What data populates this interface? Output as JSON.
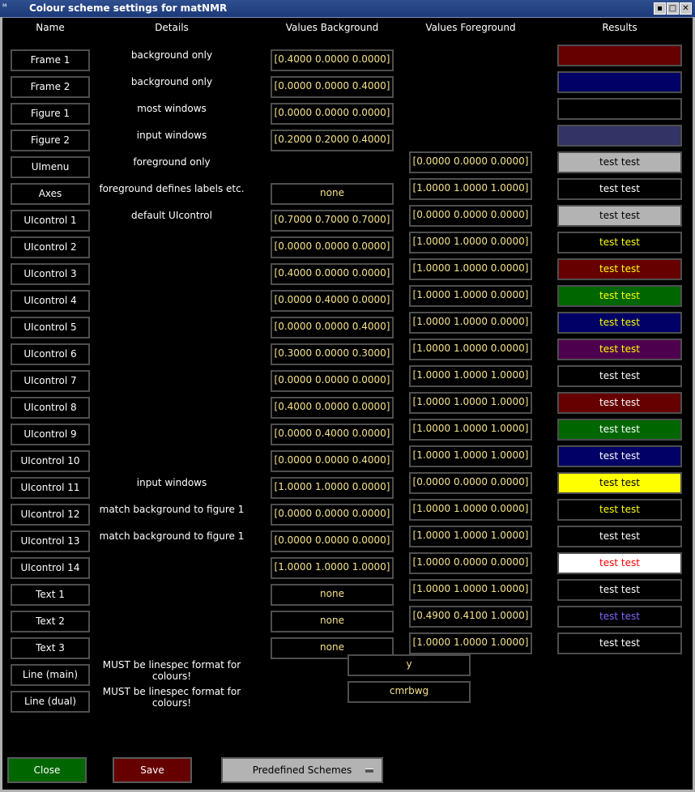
{
  "window": {
    "title": "Colour scheme settings for matNMR",
    "app_icon_label": "ᴹ"
  },
  "headers": {
    "name": "Name",
    "details": "Details",
    "values_background": "Values Background",
    "values_foreground": "Values Foreground",
    "results": "Results"
  },
  "rows": [
    {
      "name": "Frame 1",
      "details": "background only",
      "bg": "[0.4000 0.0000 0.0000]",
      "fg": "",
      "result": "",
      "res_bg": "#660000",
      "res_fg": "#ffffff"
    },
    {
      "name": "Frame 2",
      "details": "background only",
      "bg": "[0.0000 0.0000 0.4000]",
      "fg": "",
      "result": "",
      "res_bg": "#000066",
      "res_fg": "#ffffff"
    },
    {
      "name": "Figure 1",
      "details": "most windows",
      "bg": "[0.0000 0.0000 0.0000]",
      "fg": "",
      "result": "",
      "res_bg": "#000000",
      "res_fg": "#ffffff"
    },
    {
      "name": "Figure 2",
      "details": "input windows",
      "bg": "[0.2000 0.2000 0.4000]",
      "fg": "",
      "result": "",
      "res_bg": "#333366",
      "res_fg": "#ffffff"
    },
    {
      "name": "UImenu",
      "details": "foreground only",
      "bg": "",
      "fg": "[0.0000 0.0000 0.0000]",
      "result": "test test",
      "res_bg": "#b3b3b3",
      "res_fg": "#000000"
    },
    {
      "name": "Axes",
      "details": "foreground defines labels etc.",
      "bg": "none",
      "fg": "[1.0000 1.0000 1.0000]",
      "result": "test test",
      "res_bg": "#000000",
      "res_fg": "#ffffff"
    },
    {
      "name": "UIcontrol 1",
      "details": "default UIcontrol",
      "bg": "[0.7000 0.7000 0.7000]",
      "fg": "[0.0000 0.0000 0.0000]",
      "result": "test test",
      "res_bg": "#b3b3b3",
      "res_fg": "#000000"
    },
    {
      "name": "UIcontrol 2",
      "details": "",
      "bg": "[0.0000 0.0000 0.0000]",
      "fg": "[1.0000 1.0000 0.0000]",
      "result": "test test",
      "res_bg": "#000000",
      "res_fg": "#ffff00"
    },
    {
      "name": "UIcontrol 3",
      "details": "",
      "bg": "[0.4000 0.0000 0.0000]",
      "fg": "[1.0000 1.0000 0.0000]",
      "result": "test test",
      "res_bg": "#660000",
      "res_fg": "#ffff00"
    },
    {
      "name": "UIcontrol 4",
      "details": "",
      "bg": "[0.0000 0.4000 0.0000]",
      "fg": "[1.0000 1.0000 0.0000]",
      "result": "test test",
      "res_bg": "#006600",
      "res_fg": "#ffff00"
    },
    {
      "name": "UIcontrol 5",
      "details": "",
      "bg": "[0.0000 0.0000 0.4000]",
      "fg": "[1.0000 1.0000 0.0000]",
      "result": "test test",
      "res_bg": "#000066",
      "res_fg": "#ffff00"
    },
    {
      "name": "UIcontrol 6",
      "details": "",
      "bg": "[0.3000 0.0000 0.3000]",
      "fg": "[1.0000 1.0000 0.0000]",
      "result": "test test",
      "res_bg": "#4d004d",
      "res_fg": "#ffff00"
    },
    {
      "name": "UIcontrol 7",
      "details": "",
      "bg": "[0.0000 0.0000 0.0000]",
      "fg": "[1.0000 1.0000 1.0000]",
      "result": "test test",
      "res_bg": "#000000",
      "res_fg": "#ffffff"
    },
    {
      "name": "UIcontrol 8",
      "details": "",
      "bg": "[0.4000 0.0000 0.0000]",
      "fg": "[1.0000 1.0000 1.0000]",
      "result": "test test",
      "res_bg": "#660000",
      "res_fg": "#ffffff"
    },
    {
      "name": "UIcontrol 9",
      "details": "",
      "bg": "[0.0000 0.4000 0.0000]",
      "fg": "[1.0000 1.0000 1.0000]",
      "result": "test test",
      "res_bg": "#006600",
      "res_fg": "#ffffff"
    },
    {
      "name": "UIcontrol 10",
      "details": "",
      "bg": "[0.0000 0.0000 0.4000]",
      "fg": "[1.0000 1.0000 1.0000]",
      "result": "test test",
      "res_bg": "#000066",
      "res_fg": "#ffffff"
    },
    {
      "name": "UIcontrol 11",
      "details": "input windows",
      "bg": "[1.0000 1.0000 0.0000]",
      "fg": "[0.0000 0.0000 0.0000]",
      "result": "test test",
      "res_bg": "#ffff00",
      "res_fg": "#000000"
    },
    {
      "name": "UIcontrol 12",
      "details": "match background to figure 1",
      "bg": "[0.0000 0.0000 0.0000]",
      "fg": "[1.0000 1.0000 0.0000]",
      "result": "test test",
      "res_bg": "#000000",
      "res_fg": "#ffff00"
    },
    {
      "name": "UIcontrol 13",
      "details": "match background to figure 1",
      "bg": "[0.0000 0.0000 0.0000]",
      "fg": "[1.0000 1.0000 1.0000]",
      "result": "test test",
      "res_bg": "#000000",
      "res_fg": "#ffffff"
    },
    {
      "name": "UIcontrol 14",
      "details": "",
      "bg": "[1.0000 1.0000 1.0000]",
      "fg": "[1.0000 0.0000 0.0000]",
      "result": "test test",
      "res_bg": "#ffffff",
      "res_fg": "#ff0000"
    },
    {
      "name": "Text 1",
      "details": "",
      "bg": "none",
      "fg": "[1.0000 1.0000 1.0000]",
      "result": "test test",
      "res_bg": "#000000",
      "res_fg": "#ffffff"
    },
    {
      "name": "Text 2",
      "details": "",
      "bg": "none",
      "fg": "[0.4900 0.4100 1.0000]",
      "result": "test test",
      "res_bg": "#000000",
      "res_fg": "#7d69ff"
    },
    {
      "name": "Text 3",
      "details": "",
      "bg": "none",
      "fg": "[1.0000 1.0000 1.0000]",
      "result": "test test",
      "res_bg": "#000000",
      "res_fg": "#ffffff"
    }
  ],
  "lines": [
    {
      "name": "Line (main)",
      "details": "MUST be linespec format for colours!",
      "value": "y"
    },
    {
      "name": "Line (dual)",
      "details": "MUST be linespec format for colours!",
      "value": "cmrbwg"
    }
  ],
  "buttons": {
    "close": "Close",
    "save": "Save",
    "predefined": "Predefined Schemes"
  },
  "colors": {
    "close_bg": "#006600",
    "save_bg": "#660000",
    "popup_bg": "#b3b3b3",
    "value_text": "#f5e28c"
  }
}
